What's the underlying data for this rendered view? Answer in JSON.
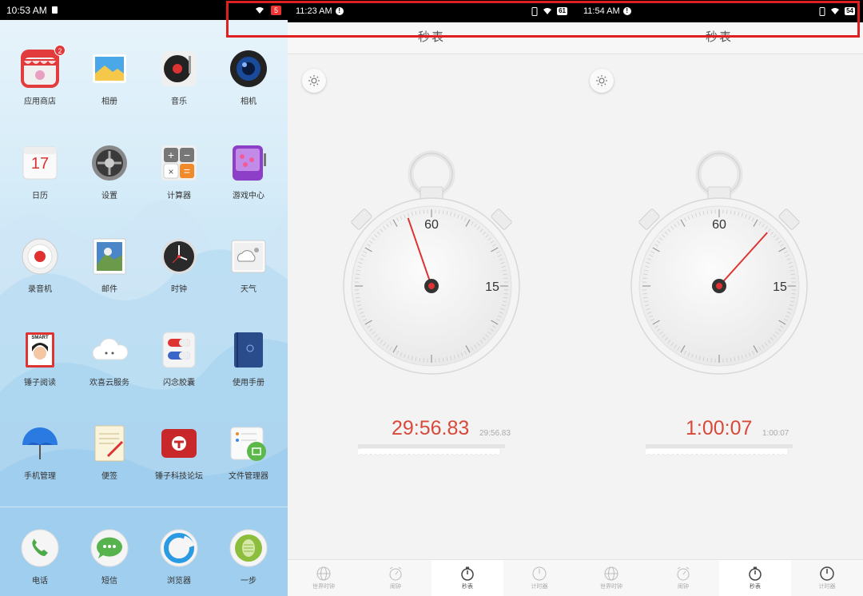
{
  "left_panel": {
    "status_time": "10:53 AM",
    "status_badge": "5",
    "apps": [
      {
        "label": "应用商店",
        "icon": "app-store-icon",
        "badge": "2"
      },
      {
        "label": "相册",
        "icon": "gallery-icon"
      },
      {
        "label": "音乐",
        "icon": "music-icon"
      },
      {
        "label": "相机",
        "icon": "camera-icon"
      },
      {
        "label": "日历",
        "icon": "calendar-icon",
        "day": "17"
      },
      {
        "label": "设置",
        "icon": "settings-icon"
      },
      {
        "label": "计算器",
        "icon": "calculator-icon"
      },
      {
        "label": "游戏中心",
        "icon": "game-center-icon"
      },
      {
        "label": "录音机",
        "icon": "recorder-icon"
      },
      {
        "label": "邮件",
        "icon": "mail-icon"
      },
      {
        "label": "时钟",
        "icon": "clock-icon"
      },
      {
        "label": "天气",
        "icon": "weather-icon"
      },
      {
        "label": "锤子阅读",
        "icon": "reader-icon",
        "icon_text": "SMART"
      },
      {
        "label": "欢喜云服务",
        "icon": "cloud-service-icon"
      },
      {
        "label": "闪念胶囊",
        "icon": "capsule-icon"
      },
      {
        "label": "使用手册",
        "icon": "manual-icon"
      },
      {
        "label": "手机管理",
        "icon": "phone-manager-icon"
      },
      {
        "label": "便签",
        "icon": "notes-icon"
      },
      {
        "label": "锤子科技论坛",
        "icon": "forum-icon"
      },
      {
        "label": "文件管理器",
        "icon": "file-manager-icon"
      }
    ],
    "dock": [
      {
        "label": "电话",
        "icon": "phone-icon"
      },
      {
        "label": "短信",
        "icon": "messages-icon"
      },
      {
        "label": "浏览器",
        "icon": "browser-icon"
      },
      {
        "label": "一步",
        "icon": "one-step-icon"
      }
    ]
  },
  "stopwatch_panels": [
    {
      "status_time": "11:23 AM",
      "battery": "61",
      "title": "秒表",
      "dial_labels": {
        "top": "60",
        "right": "15"
      },
      "hand_seconds": 56.83,
      "elapsed": "29:56.83",
      "lap": "29:56.83",
      "tabs": [
        {
          "label": "世界时钟",
          "icon": "globe-icon",
          "active": false
        },
        {
          "label": "闹钟",
          "icon": "alarm-icon",
          "active": false
        },
        {
          "label": "秒表",
          "icon": "stopwatch-icon",
          "active": true
        },
        {
          "label": "计时器",
          "icon": "timer-icon",
          "active": false
        }
      ]
    },
    {
      "status_time": "11:54 AM",
      "battery": "54",
      "title": "秒表",
      "dial_labels": {
        "top": "60",
        "right": "15"
      },
      "hand_seconds": 7,
      "elapsed": "1:00:07",
      "lap": "1:00:07",
      "tabs": [
        {
          "label": "世界时钟",
          "icon": "globe-icon",
          "active": false
        },
        {
          "label": "闹钟",
          "icon": "alarm-icon",
          "active": false
        },
        {
          "label": "秒表",
          "icon": "stopwatch-icon",
          "active": true
        },
        {
          "label": "计时器",
          "icon": "timer-icon",
          "active": false
        }
      ]
    }
  ],
  "colors": {
    "accent_red": "#d8493a",
    "highlight_box": "#e02020"
  }
}
